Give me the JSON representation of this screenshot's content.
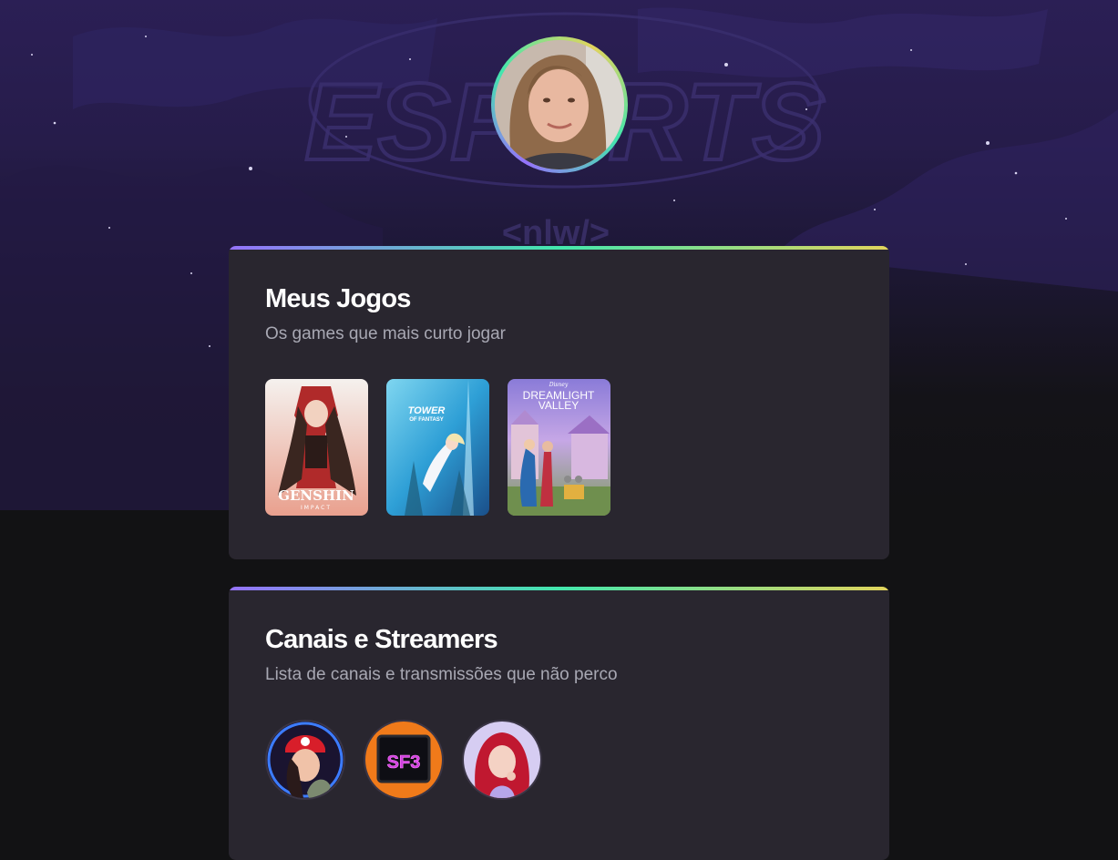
{
  "background": {
    "watermark_text": "ESPORTS",
    "watermark_sub": "<nlw/>"
  },
  "profile": {
    "avatar_icon": "user-avatar-photo"
  },
  "games_section": {
    "title": "Meus Jogos",
    "subtitle": "Os games que mais curto jogar",
    "games": [
      {
        "name": "Genshin Impact",
        "logo_line1": "GENSHIN",
        "logo_line2": "IMPACT"
      },
      {
        "name": "Tower of Fantasy",
        "logo_line1": "TOWER",
        "logo_line2": "OF FANTASY"
      },
      {
        "name": "Disney Dreamlight Valley",
        "logo_top": "Disney",
        "logo_line1": "DREAMLIGHT",
        "logo_line2": "VALLEY"
      }
    ]
  },
  "streamers_section": {
    "title": "Canais e Streamers",
    "subtitle": "Lista de canais e transmissões que não perco",
    "streamers": [
      {
        "name": "streamer-1"
      },
      {
        "name": "streamer-2",
        "logo_text": "SF3"
      },
      {
        "name": "streamer-3"
      }
    ]
  },
  "colors": {
    "gradient_start": "#9572fc",
    "gradient_mid": "#43e7ad",
    "gradient_end": "#e2d45c",
    "card_bg": "#29262f"
  }
}
